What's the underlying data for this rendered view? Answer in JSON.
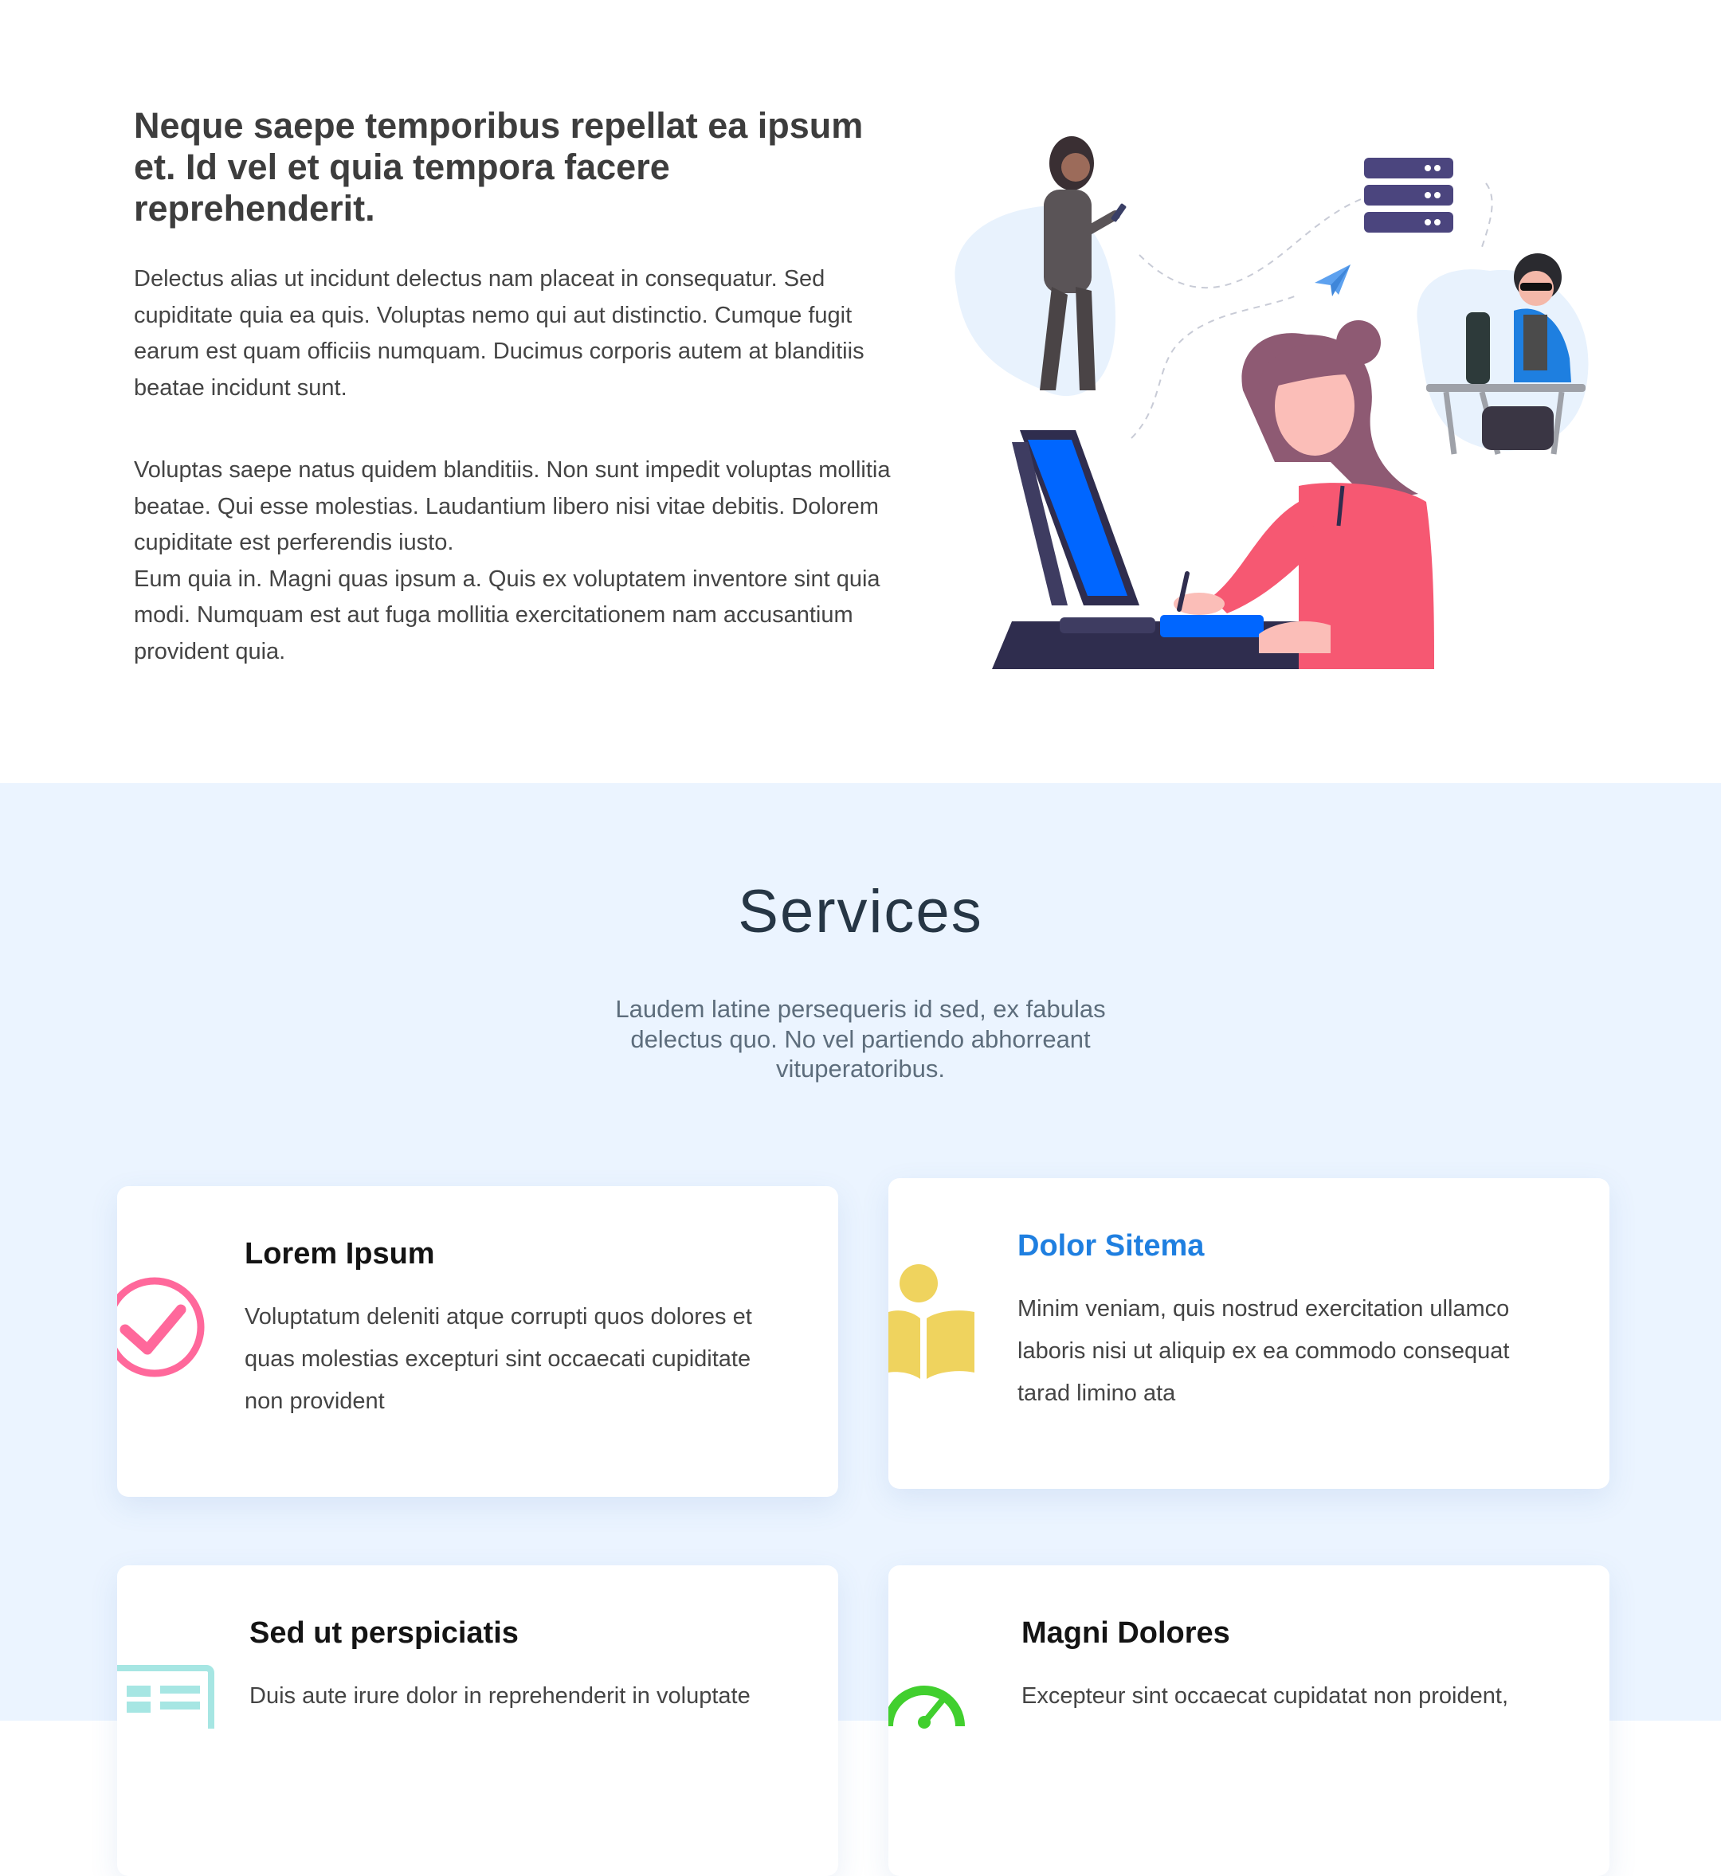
{
  "about": {
    "title": "Neque saepe temporibus repellat ea ipsum et. Id vel et quia tempora facere reprehenderit.",
    "paragraph_1": "Delectus alias ut incidunt delectus nam placeat in consequatur. Sed cupiditate quia ea quis. Voluptas nemo qui aut distinctio. Cumque fugit earum est quam officiis numquam. Ducimus corporis autem at blanditiis beatae incidunt sunt.",
    "paragraph_2": "Voluptas saepe natus quidem blanditiis. Non sunt impedit voluptas mollitia beatae. Qui esse molestias. Laudantium libero nisi vitae debitis. Dolorem cupiditate est perferendis iusto.",
    "paragraph_3": "Eum quia in. Magni quas ipsum a. Quis ex voluptatem inventore sint quia modi. Numquam est aut fuga mollitia exercitationem nam accusantium provident quia."
  },
  "services": {
    "title": "Services",
    "subtitle": "Laudem latine persequeris id sed, ex fabulas delectus quo. No vel partiendo abhorreant vituperatoribus.",
    "items": [
      {
        "title": "Lorem Ipsum",
        "text": "Voluptatum deleniti atque corrupti quos dolores et quas molestias excepturi sint occaecati cupiditate non provident",
        "icon": "check-circle-icon",
        "color": "#ff689b"
      },
      {
        "title": "Dolor Sitema",
        "text": "Minim veniam, quis nostrud exercitation ullamco laboris nisi ut aliquip ex ea commodo consequat tarad limino ata",
        "icon": "book-reader-icon",
        "color": "#e9bf06"
      },
      {
        "title": "Sed ut perspiciatis",
        "text": "Duis aute irure dolor in reprehenderit in voluptate",
        "icon": "newspaper-icon",
        "color": "#3fcdc7"
      },
      {
        "title": "Magni Dolores",
        "text": "Excepteur sint occaecat cupidatat non proident,",
        "icon": "speedometer-icon",
        "color": "#41cf2e"
      }
    ],
    "highlight_color": "#1f7fe0"
  }
}
